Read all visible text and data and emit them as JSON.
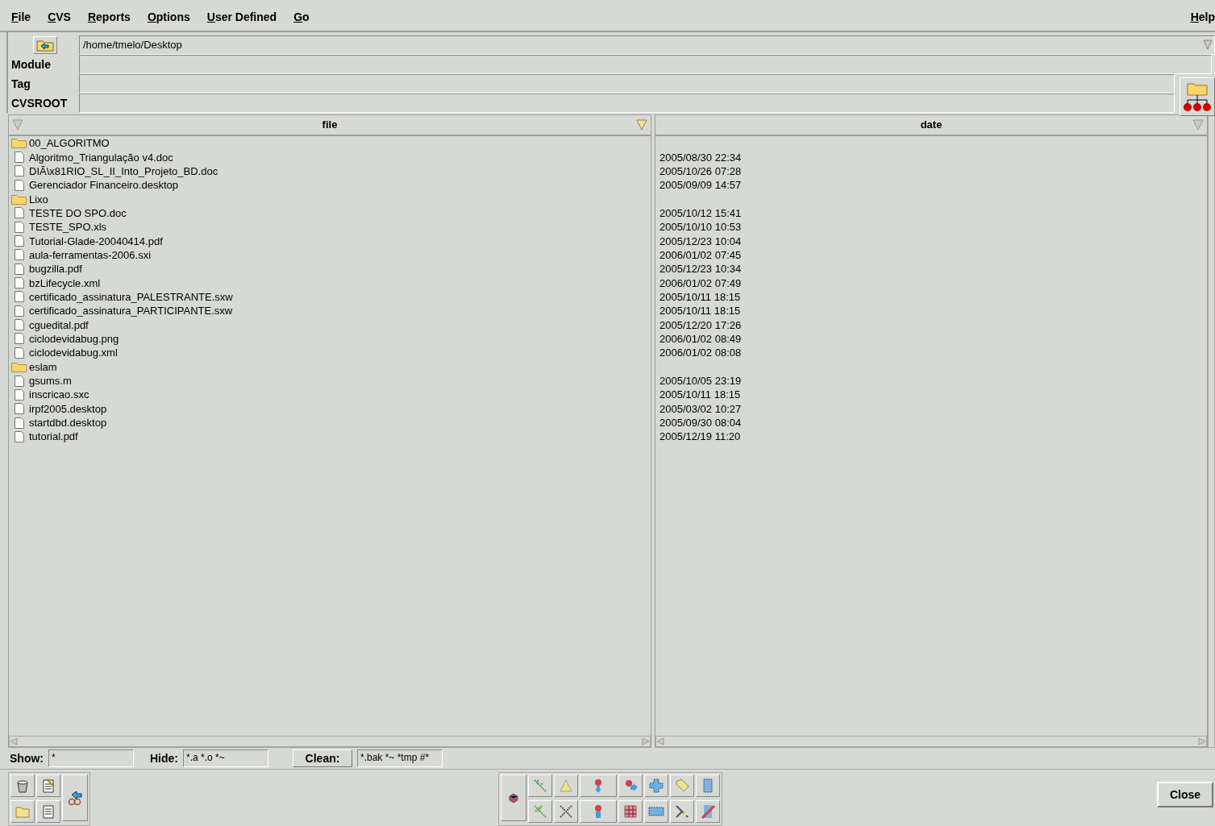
{
  "menu": [
    "File",
    "CVS",
    "Reports",
    "Options",
    "User Defined",
    "Go"
  ],
  "help_menu": "Help",
  "path": {
    "value": "/home/tmelo/Desktop"
  },
  "fields": [
    {
      "label": "Module"
    },
    {
      "label": "Tag"
    },
    {
      "label": "CVSROOT"
    }
  ],
  "columns": [
    "file",
    "date"
  ],
  "files": [
    {
      "kind": "folder",
      "name": "00_ALGORITMO"
    },
    {
      "kind": "file",
      "name": "Algoritmo_Triangulação v4.doc",
      "date": "2005/08/30 22:34"
    },
    {
      "kind": "file",
      "name": "DIÃ\\x81RIO_SL_II_Into_Projeto_BD.doc",
      "date": "2005/10/26 07:28"
    },
    {
      "kind": "file",
      "name": "Gerenciador Financeiro.desktop",
      "date": "2005/09/09 14:57"
    },
    {
      "kind": "folder",
      "name": "Lixo"
    },
    {
      "kind": "file",
      "name": "TESTE DO SPO.doc",
      "date": "2005/10/12 15:41"
    },
    {
      "kind": "file",
      "name": "TESTE_SPO.xls",
      "date": "2005/10/10 10:53"
    },
    {
      "kind": "file",
      "name": "Tutorial-Glade-20040414.pdf",
      "date": "2005/12/23 10:04"
    },
    {
      "kind": "file",
      "name": "aula-ferramentas-2006.sxi",
      "date": "2006/01/02 07:45"
    },
    {
      "kind": "file",
      "name": "bugzilla.pdf",
      "date": "2005/12/23 10:34"
    },
    {
      "kind": "file",
      "name": "bzLifecycle.xml",
      "date": "2006/01/02 07:49"
    },
    {
      "kind": "file",
      "name": "certificado_assinatura_PALESTRANTE.sxw",
      "date": "2005/10/11 18:15"
    },
    {
      "kind": "file",
      "name": "certificado_assinatura_PARTICIPANTE.sxw",
      "date": "2005/10/11 18:15"
    },
    {
      "kind": "file",
      "name": "cguedital.pdf",
      "date": "2005/12/20 17:26"
    },
    {
      "kind": "file",
      "name": "ciclodevidabug.png",
      "date": "2006/01/02 08:49"
    },
    {
      "kind": "file",
      "name": "ciclodevidabug.xml",
      "date": "2006/01/02 08:08"
    },
    {
      "kind": "folder",
      "name": "eslam"
    },
    {
      "kind": "file",
      "name": "gsums.m",
      "date": "2005/10/05 23:19"
    },
    {
      "kind": "file",
      "name": "inscricao.sxc",
      "date": "2005/10/11 18:15"
    },
    {
      "kind": "file",
      "name": "irpf2005.desktop",
      "date": "2005/03/02 10:27"
    },
    {
      "kind": "file",
      "name": "startdbd.desktop",
      "date": "2005/09/30 08:04"
    },
    {
      "kind": "file",
      "name": "tutorial.pdf",
      "date": "2005/12/19 11:20"
    }
  ],
  "filters": {
    "show_label": "Show:",
    "show": "*",
    "hide_label": "Hide:",
    "hide": "*.a *.o *~",
    "clean_button": "Clean:",
    "clean": "*.bak *~ *tmp #*"
  },
  "close_button": "Close"
}
